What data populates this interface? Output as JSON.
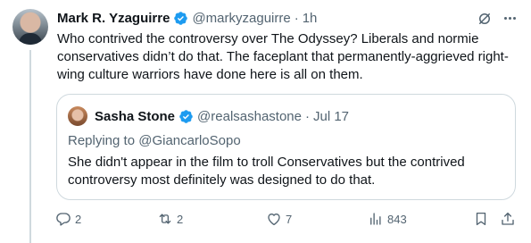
{
  "tweet": {
    "author_name": "Mark R. Yzaguirre",
    "author_handle": "@markyzaguirre",
    "separator": "·",
    "time": "1h",
    "text": "Who contrived the controversy over The Odyssey? Liberals and normie conservatives didn’t do that. The faceplant that permanently-aggrieved right-wing culture warriors have done here is all on them."
  },
  "quote": {
    "author_name": "Sasha Stone",
    "author_handle": "@realsashastone",
    "separator": "·",
    "date": "Jul 17",
    "replying_prefix": "Replying to ",
    "replying_to": "@GiancarloSopo",
    "text": "She didn't appear in the film to troll Conservatives but the contrived controversy most definitely was designed to do that."
  },
  "actions": {
    "replies": "2",
    "reposts": "2",
    "likes": "7",
    "views": "843"
  },
  "icons": [
    "verified-badge-icon",
    "grok-icon",
    "more-icon",
    "reply-icon",
    "repost-icon",
    "like-icon",
    "views-icon",
    "bookmark-icon",
    "share-icon"
  ],
  "colors": {
    "verified": "#1d9bf0",
    "secondary_text": "#536471",
    "border": "#cfd9de"
  }
}
